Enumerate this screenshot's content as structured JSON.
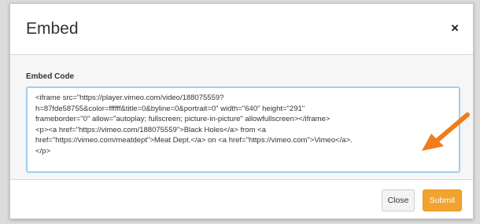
{
  "dialog": {
    "title": "Embed",
    "close_label": "×"
  },
  "body": {
    "field_label": "Embed Code",
    "code_value": "<iframe src=\"https://player.vimeo.com/video/188075559?\nh=87fde58755&color=ffffff&title=0&byline=0&portrait=0\" width=\"640\" height=\"291\"\nframeborder=\"0\" allow=\"autoplay; fullscreen; picture-in-picture\" allowfullscreen></iframe>\n<p><a href=\"https://vimeo.com/188075559\">Black Holes</a> from <a\nhref=\"https://vimeo.com/meatdept\">Meat Dept.</a> on <a href=\"https://vimeo.com\">Vimeo</a>.\n</p>"
  },
  "footer": {
    "close_button": "Close",
    "submit_button": "Submit"
  },
  "colors": {
    "accent": "#f2a22e",
    "focus_border": "#9fd0ec",
    "arrow": "#f07d1c"
  },
  "icons": {
    "close": "close-icon",
    "annotation": "arrow-icon"
  }
}
